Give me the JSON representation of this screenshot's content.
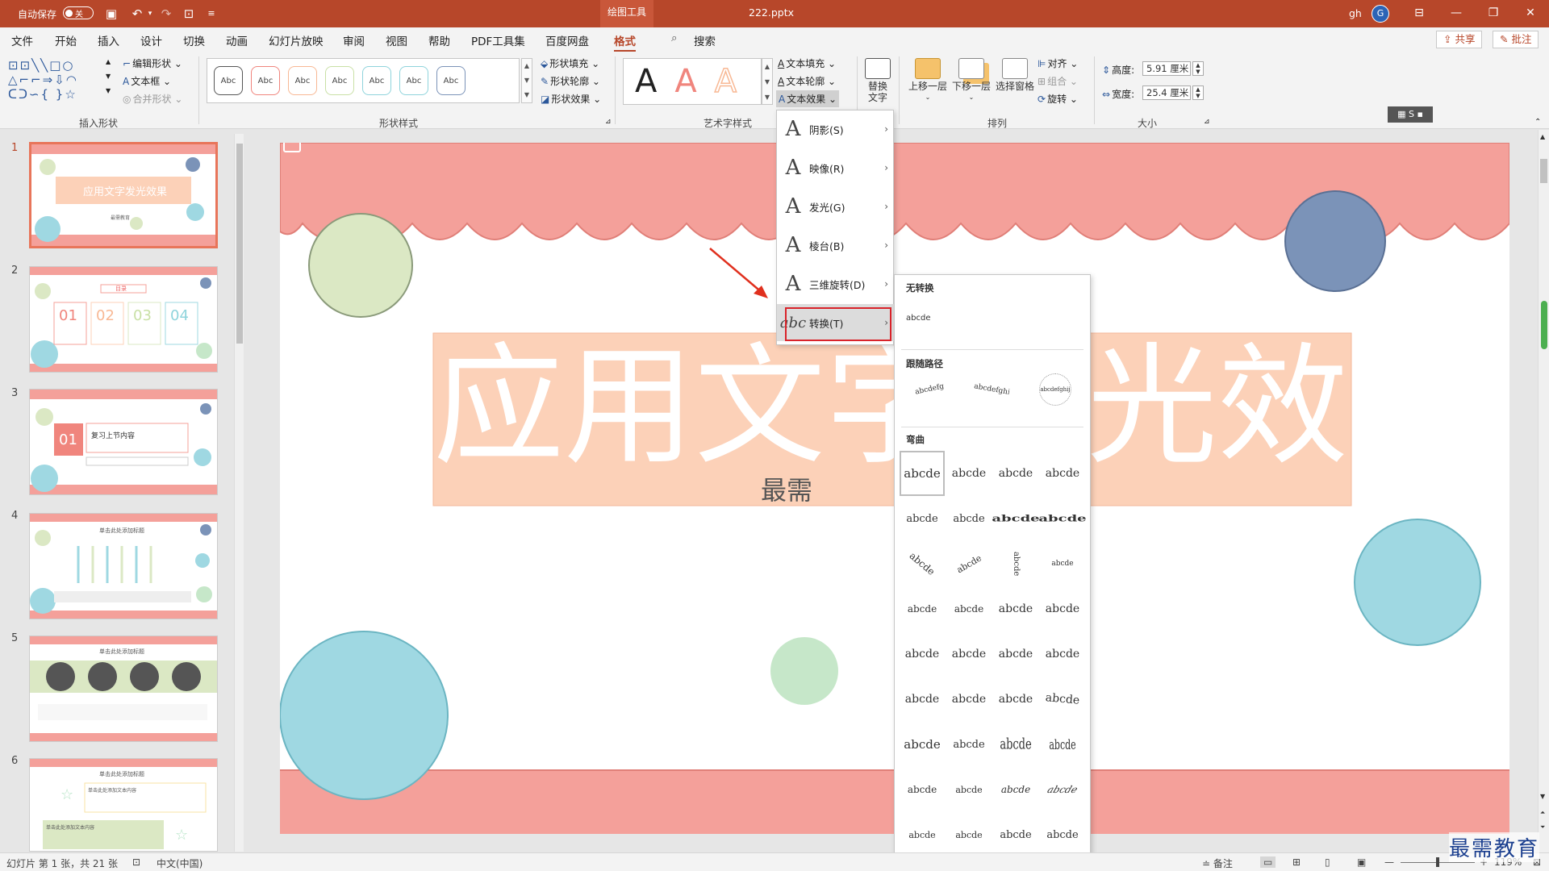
{
  "titlebar": {
    "autosave_label": "自动保存",
    "autosave_state": "关",
    "context_tab": "绘图工具",
    "filename": "222.pptx",
    "user": "gh",
    "avatar_letter": "G",
    "win_restore_icon": "ribbon-display-icon",
    "win_min": "—",
    "win_max": "❐",
    "win_close": "✕"
  },
  "menu": {
    "items": [
      "文件",
      "开始",
      "插入",
      "设计",
      "切换",
      "动画",
      "幻灯片放映",
      "审阅",
      "视图",
      "帮助",
      "PDF工具集",
      "百度网盘",
      "格式"
    ],
    "search": "搜索",
    "share": "共享",
    "comments": "批注"
  },
  "ribbon": {
    "insert_shapes": {
      "edit_shape": "编辑形状",
      "textbox": "文本框",
      "merge_shapes": "合并形状",
      "group_label": "插入形状"
    },
    "shape_styles": {
      "samples": [
        "Abc",
        "Abc",
        "Abc",
        "Abc",
        "Abc",
        "Abc",
        "Abc"
      ],
      "fill": "形状填充",
      "outline": "形状轮廓",
      "effects": "形状效果",
      "group_label": "形状样式"
    },
    "wordart": {
      "samples": [
        "A",
        "A",
        "A"
      ],
      "text_fill": "文本填充",
      "text_outline": "文本轮廓",
      "text_effects": "文本效果",
      "group_label": "艺术字样式"
    },
    "alt_text": {
      "line1": "替换",
      "line2": "文字"
    },
    "arrange": {
      "bring_forward": "上移一层",
      "send_backward": "下移一层",
      "selection_pane": "选择窗格",
      "align": "对齐",
      "group": "组合",
      "rotate": "旋转",
      "group_label": "排列"
    },
    "size": {
      "height_label": "高度:",
      "height_value": "5.91 厘米",
      "width_label": "宽度:",
      "width_value": "25.4 厘米",
      "group_label": "大小"
    }
  },
  "text_effects_menu": {
    "items": [
      {
        "label": "阴影(S)",
        "icon": "A"
      },
      {
        "label": "映像(R)",
        "icon": "A"
      },
      {
        "label": "发光(G)",
        "icon": "A"
      },
      {
        "label": "棱台(B)",
        "icon": "A"
      },
      {
        "label": "三维旋转(D)",
        "icon": "A"
      },
      {
        "label": "转换(T)",
        "icon": "abc"
      }
    ]
  },
  "transform_submenu": {
    "no_transform_header": "无转换",
    "no_transform_sample": "abcde",
    "follow_path_header": "跟随路径",
    "path_samples": [
      "abcdefg",
      "abcdefghij",
      "abcdefghijklm"
    ],
    "warp_header": "弯曲",
    "warp_samples": [
      "abcde",
      "abcde",
      "abcde",
      "abcde",
      "abcde",
      "abcde",
      "abcde",
      "abcde",
      "abcde",
      "abcde",
      "abcde",
      "abcde",
      "abcde",
      "abcde",
      "abcde",
      "abcde",
      "abcde",
      "abcde",
      "abcde",
      "abcde",
      "abcde",
      "abcde",
      "abcde",
      "abcde",
      "abcde",
      "abcde",
      "abcde",
      "abcde",
      "abcde",
      "abcde",
      "abcde",
      "abcde",
      "abcde",
      "abcde",
      "abcde",
      "abcde"
    ],
    "more": "....."
  },
  "slide": {
    "title": "应用文字发光效果",
    "subtitle_partial": "最需"
  },
  "thumbnails": {
    "numbers": [
      "1",
      "2",
      "3",
      "4",
      "5",
      "6"
    ],
    "t1_title": "应用文字发光效果",
    "t1_sub": "最需教育",
    "t2_header": "目录",
    "t2_nums": [
      "01",
      "02",
      "03",
      "04"
    ],
    "t3_num": "01",
    "t3_text": "复习上节内容",
    "t4_title": "单击此处添加标题",
    "t5_title": "单击此处添加标题",
    "t6_title": "单击此处添加标题",
    "t6_text1": "单击此处添加文本内容",
    "t6_text2": "单击此处添加文本内容"
  },
  "status": {
    "slide_info": "幻灯片 第 1 张，共 21 张",
    "language": "中文(中国)",
    "notes": "备注",
    "zoom": "119%"
  },
  "watermark": "最需教育",
  "colors": {
    "accent": "#b7472a",
    "pink": "#f4a09a",
    "peach": "#fcd1b8",
    "teal": "#9fd8e2",
    "green": "#dbe8c4",
    "blue": "#7b93b8",
    "highlight": "#d9232a"
  }
}
